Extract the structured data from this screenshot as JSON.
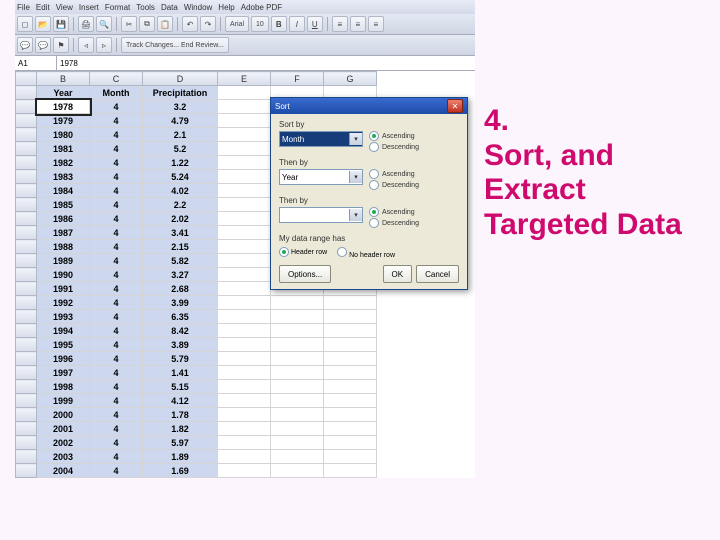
{
  "slide": {
    "title_l1": "4.",
    "title_l2": "Sort, and Extract Targeted Data"
  },
  "menubar": [
    "File",
    "Edit",
    "View",
    "Insert",
    "Format",
    "Tools",
    "Data",
    "Window",
    "Help",
    "Adobe PDF"
  ],
  "toolbar1_font": "Arial",
  "toolbar1_size": "10",
  "toolbar_track": "Track Changes... End Review...",
  "name_box": "A1",
  "formula": "1978",
  "columns": [
    "B",
    "C",
    "D",
    "E",
    "F",
    "G"
  ],
  "headers": {
    "b": "Year",
    "c": "Month",
    "d": "Precipitation"
  },
  "rows": [
    {
      "y": "1978",
      "m": "4",
      "p": "3.2"
    },
    {
      "y": "1979",
      "m": "4",
      "p": "4.79"
    },
    {
      "y": "1980",
      "m": "4",
      "p": "2.1"
    },
    {
      "y": "1981",
      "m": "4",
      "p": "5.2"
    },
    {
      "y": "1982",
      "m": "4",
      "p": "1.22"
    },
    {
      "y": "1983",
      "m": "4",
      "p": "5.24"
    },
    {
      "y": "1984",
      "m": "4",
      "p": "4.02"
    },
    {
      "y": "1985",
      "m": "4",
      "p": "2.2"
    },
    {
      "y": "1986",
      "m": "4",
      "p": "2.02"
    },
    {
      "y": "1987",
      "m": "4",
      "p": "3.41"
    },
    {
      "y": "1988",
      "m": "4",
      "p": "2.15"
    },
    {
      "y": "1989",
      "m": "4",
      "p": "5.82"
    },
    {
      "y": "1990",
      "m": "4",
      "p": "3.27"
    },
    {
      "y": "1991",
      "m": "4",
      "p": "2.68"
    },
    {
      "y": "1992",
      "m": "4",
      "p": "3.99"
    },
    {
      "y": "1993",
      "m": "4",
      "p": "6.35"
    },
    {
      "y": "1994",
      "m": "4",
      "p": "8.42"
    },
    {
      "y": "1995",
      "m": "4",
      "p": "3.89"
    },
    {
      "y": "1996",
      "m": "4",
      "p": "5.79"
    },
    {
      "y": "1997",
      "m": "4",
      "p": "1.41"
    },
    {
      "y": "1998",
      "m": "4",
      "p": "5.15"
    },
    {
      "y": "1999",
      "m": "4",
      "p": "4.12"
    },
    {
      "y": "2000",
      "m": "4",
      "p": "1.78"
    },
    {
      "y": "2001",
      "m": "4",
      "p": "1.82"
    },
    {
      "y": "2002",
      "m": "4",
      "p": "5.97"
    },
    {
      "y": "2003",
      "m": "4",
      "p": "1.89"
    },
    {
      "y": "2004",
      "m": "4",
      "p": "1.69"
    }
  ],
  "sort": {
    "title": "Sort",
    "sortby": "Sort by",
    "thenby": "Then by",
    "sel1": "Month",
    "sel2": "Year",
    "sel3": "",
    "asc": "Ascending",
    "desc": "Descending",
    "range_label": "My data range has",
    "headerrow": "Header row",
    "noheader": "No header row",
    "options": "Options...",
    "ok": "OK",
    "cancel": "Cancel"
  }
}
